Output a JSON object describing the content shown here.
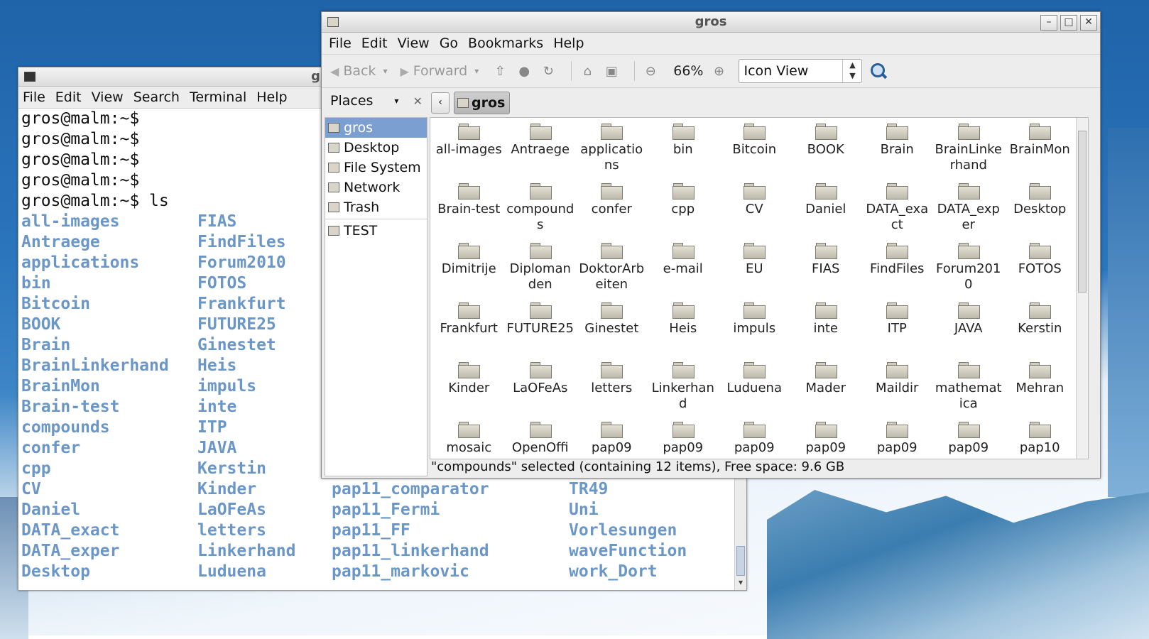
{
  "terminal": {
    "title": "gros@malm: ~",
    "menu": [
      "File",
      "Edit",
      "View",
      "Search",
      "Terminal",
      "Help"
    ],
    "prompt_lines": [
      "gros@malm:~$",
      "gros@malm:~$",
      "gros@malm:~$",
      "gros@malm:~$",
      "gros@malm:~$ ls"
    ],
    "ls_col1": [
      "all-images",
      "Antraege",
      "applications",
      "bin",
      "Bitcoin",
      "BOOK",
      "Brain",
      "BrainLinkerhand",
      "BrainMon",
      "Brain-test",
      "compounds",
      "confer",
      "cpp",
      "CV",
      "Daniel",
      "DATA_exact",
      "DATA_exper",
      "Desktop"
    ],
    "ls_col2": [
      "FIAS",
      "FindFiles",
      "Forum2010",
      "FOTOS",
      "Frankfurt",
      "FUTURE25",
      "Ginestet",
      "Heis",
      "impuls",
      "inte",
      "ITP",
      "JAVA",
      "Kerstin",
      "Kinder",
      "LaOFeAs",
      "letters",
      "Linkerhand",
      "Luduena"
    ],
    "ls_col3_visible": [
      "pap11_comparator",
      "pap11_Fermi",
      "pap11_FF",
      "pap11_linkerhand",
      "pap11_markovic"
    ],
    "ls_col4_visible": [
      "TR49",
      "Uni",
      "Vorlesungen",
      "waveFunction",
      "work_Dort"
    ]
  },
  "filemanager": {
    "title": "gros",
    "menu": [
      "File",
      "Edit",
      "View",
      "Go",
      "Bookmarks",
      "Help"
    ],
    "toolbar": {
      "back": "Back",
      "forward": "Forward",
      "zoom": "66%",
      "view_mode": "Icon View"
    },
    "sidebar": {
      "header": "Places",
      "items": [
        {
          "label": "gros",
          "selected": true
        },
        {
          "label": "Desktop"
        },
        {
          "label": "File System"
        },
        {
          "label": "Network"
        },
        {
          "label": "Trash"
        },
        {
          "label": "TEST"
        }
      ]
    },
    "path": {
      "current": "gros"
    },
    "folders": [
      "all-images",
      "Antraege",
      "applications",
      "bin",
      "Bitcoin",
      "BOOK",
      "Brain",
      "BrainLinkerhand",
      "BrainMon",
      "Brain-test",
      "compounds",
      "confer",
      "cpp",
      "CV",
      "Daniel",
      "DATA_exact",
      "DATA_exper",
      "Desktop",
      "Dimitrije",
      "Diplomanden",
      "DoktorArbeiten",
      "e-mail",
      "EU",
      "FIAS",
      "FindFiles",
      "Forum2010",
      "FOTOS",
      "Frankfurt",
      "FUTURE25",
      "Ginestet",
      "Heis",
      "impuls",
      "inte",
      "ITP",
      "JAVA",
      "Kerstin",
      "Kinder",
      "LaOFeAs",
      "letters",
      "Linkerhand",
      "Luduena",
      "Mader",
      "Maildir",
      "mathematica",
      "Mehran",
      "mosaic",
      "OpenOffi",
      "pap09",
      "pap09",
      "pap09",
      "pap09",
      "pap09",
      "pap09",
      "pap10"
    ],
    "status": "\"compounds\" selected (containing 12 items), Free space: 9.6 GB"
  }
}
